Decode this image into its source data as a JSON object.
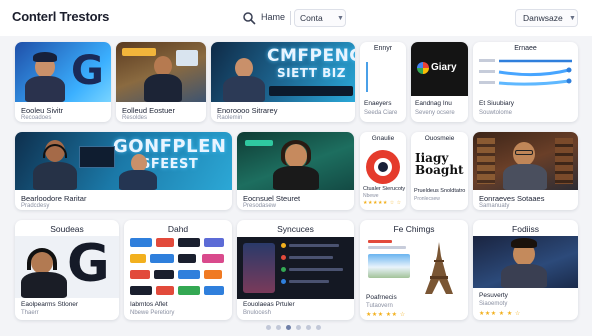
{
  "header": {
    "title": "Conterl Trestors",
    "nav_item": "Hame",
    "dropdown_label": "Conta",
    "right_dropdown_label": "Danwsaze"
  },
  "row1": [
    {
      "caption": "Eooleu Sivitr",
      "sub": "Recoadoes"
    },
    {
      "caption": "Eolleud Eostuer",
      "sub": "Resoldes"
    },
    {
      "caption": "Enoroooo Sitrarey",
      "sub": "Raolemin"
    },
    {
      "caption": "Enaeyers",
      "sub": "Seeda Ciare",
      "heading": "Ennyr"
    },
    {
      "caption": "Eandnag Inu",
      "sub": "Seveny ocsere",
      "logo_text": "Giary"
    },
    {
      "caption": "Et Siuubiary",
      "sub": "Souwtolome",
      "heading": "Ernaee"
    }
  ],
  "row2": [
    {
      "caption": "Bearloodore Raritar",
      "sub": "Pradcdesy"
    },
    {
      "caption": "Eocnsuel Steuret",
      "sub": "Presodasew"
    },
    {
      "caption": "Ctualer Sierucoty",
      "sub": "Nbewe",
      "heading": "Gnaulie",
      "stars": "★★★★★ ☆ ☆"
    },
    {
      "caption": "Prueldeus Snoldtatro",
      "sub": "Pronlecsew",
      "heading": "Ouosmeie",
      "big_text": "Iiagy Boaght"
    },
    {
      "caption": "Eonraeves Sotaaes",
      "sub": "Samanuaty"
    }
  ],
  "row3": [
    {
      "heading": "Soudeas",
      "caption": "Eaolpearms Stloner",
      "sub": "Thaerr"
    },
    {
      "heading": "Dahd",
      "caption": "Iabmtos Aflet",
      "sub": "Nbewe Peretiory"
    },
    {
      "heading": "Syncuces",
      "caption": "Eouolaeas Prtuler",
      "sub": "Bnulocesh"
    },
    {
      "heading": "Fe Chimgs",
      "caption": "Poafrnecis",
      "sub": "Tutaovern",
      "stars": "★★★ ★★ ☆"
    },
    {
      "heading": "Fodiiss",
      "caption": "Pesuverty",
      "sub": "Siaoemoty",
      "stars": "★★★ ★ ★ ☆"
    }
  ],
  "banner_texts": [
    "CMFPENG",
    "SIETT BIZ",
    "GONFPLEN",
    "SFEEST"
  ],
  "logo_letter": "G",
  "pager": {
    "count": 6,
    "active": 2
  },
  "colors": {
    "accent": "#2f7fdc",
    "star": "#f2b01e",
    "glow": "#46c6ff"
  }
}
